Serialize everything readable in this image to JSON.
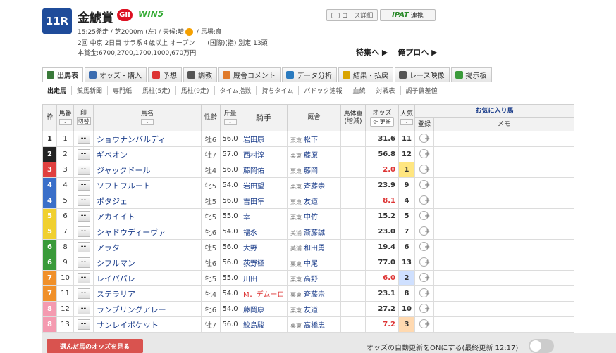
{
  "race": {
    "number": "11R",
    "name": "金鯱賞",
    "grade": "GII",
    "win5": "WIN5",
    "info_time": "15:25発走 / 芝2000m (左) / 天候:晴",
    "info_track": " / 馬場:良",
    "info_meet": "2回 中京 2日目 サラ系４歳以上 オープン　　(国際)(指) 別定 13頭",
    "info_prize": "本賞金:6700,2700,1700,1000,670万円",
    "course_btn": "コース詳細",
    "ipat_logo": "IPAT",
    "ipat_btn": "連携",
    "link_feature": "特集へ ▶",
    "link_pro": "俺プロへ ▶"
  },
  "tabs": [
    "出馬表",
    "オッズ・購入",
    "予想",
    "調教",
    "厩舎コメント",
    "データ分析",
    "結果・払戻",
    "レース映像",
    "掲示板"
  ],
  "tab_colors": [
    "#3a7a3a",
    "#3b6cb0",
    "#d33",
    "#555",
    "#e07a2a",
    "#2a7abf",
    "#d9a400",
    "#555",
    "#3a9a3a"
  ],
  "subtabs": [
    "出走馬",
    "競馬新聞",
    "専門紙",
    "馬柱(5走)",
    "馬柱(9走)",
    "タイム指数",
    "持ちタイム",
    "パドック速報",
    "血統",
    "対戦表",
    "調子偏差値"
  ],
  "headers": {
    "waku": "枠",
    "umaban": "馬番",
    "mark": "印",
    "mark_toggle": "切替",
    "horse": "馬名",
    "sexage": "性齢",
    "weight": "斤量",
    "jockey": "騎手",
    "trainer": "厩舎",
    "body_weight": "馬体重",
    "body_weight_sub": "(増減)",
    "odds": "オッズ",
    "odds_update": "更新",
    "popularity": "人気",
    "fav_group": "お気に入り馬",
    "fav_register": "登録",
    "memo": "メモ"
  },
  "rows": [
    {
      "waku": "1",
      "umaban": "1",
      "mark": "--",
      "horse": "ショウナンバルディ",
      "sexage": "牡6",
      "weight": "56.0",
      "jockey": "岩田康",
      "loc": "栗東",
      "trainer": "松下",
      "odds": "31.6",
      "pop": "11"
    },
    {
      "waku": "2",
      "umaban": "2",
      "mark": "--",
      "horse": "ギベオン",
      "sexage": "牡7",
      "weight": "57.0",
      "jockey": "西村淳",
      "loc": "栗東",
      "trainer": "藤原",
      "odds": "56.8",
      "pop": "12"
    },
    {
      "waku": "3",
      "umaban": "3",
      "mark": "--",
      "horse": "ジャックドール",
      "sexage": "牡4",
      "weight": "56.0",
      "jockey": "藤岡佑",
      "loc": "栗東",
      "trainer": "藤岡",
      "odds": "2.0",
      "pop": "1"
    },
    {
      "waku": "4",
      "umaban": "4",
      "mark": "--",
      "horse": "ソフトフルート",
      "sexage": "牝5",
      "weight": "54.0",
      "jockey": "岩田望",
      "loc": "栗東",
      "trainer": "斉藤崇",
      "odds": "23.9",
      "pop": "9"
    },
    {
      "waku": "4",
      "umaban": "5",
      "mark": "--",
      "horse": "ポタジェ",
      "sexage": "牡5",
      "weight": "56.0",
      "jockey": "吉田隼",
      "loc": "栗東",
      "trainer": "友道",
      "odds": "8.1",
      "pop": "4"
    },
    {
      "waku": "5",
      "umaban": "6",
      "mark": "--",
      "horse": "アカイイト",
      "sexage": "牝5",
      "weight": "55.0",
      "jockey": "幸",
      "loc": "栗東",
      "trainer": "中竹",
      "odds": "15.2",
      "pop": "5"
    },
    {
      "waku": "5",
      "umaban": "7",
      "mark": "--",
      "horse": "シャドウディーヴァ",
      "sexage": "牝6",
      "weight": "54.0",
      "jockey": "福永",
      "loc": "美浦",
      "trainer": "斎藤誠",
      "odds": "23.0",
      "pop": "7"
    },
    {
      "waku": "6",
      "umaban": "8",
      "mark": "--",
      "horse": "アラタ",
      "sexage": "牡5",
      "weight": "56.0",
      "jockey": "大野",
      "loc": "美浦",
      "trainer": "和田勇",
      "odds": "19.4",
      "pop": "6"
    },
    {
      "waku": "6",
      "umaban": "9",
      "mark": "--",
      "horse": "シフルマン",
      "sexage": "牡6",
      "weight": "56.0",
      "jockey": "荻野極",
      "loc": "栗東",
      "trainer": "中尾",
      "odds": "77.0",
      "pop": "13"
    },
    {
      "waku": "7",
      "umaban": "10",
      "mark": "--",
      "horse": "レイパパレ",
      "sexage": "牝5",
      "weight": "55.0",
      "jockey": "川田",
      "loc": "栗東",
      "trainer": "高野",
      "odds": "6.0",
      "pop": "2"
    },
    {
      "waku": "7",
      "umaban": "11",
      "mark": "--",
      "horse": "ステラリア",
      "sexage": "牝4",
      "weight": "54.0",
      "jockey": "M．デムーロ",
      "loc": "栗東",
      "trainer": "斉藤崇",
      "odds": "23.1",
      "pop": "8"
    },
    {
      "waku": "8",
      "umaban": "12",
      "mark": "--",
      "horse": "ランブリングアレー",
      "sexage": "牝6",
      "weight": "54.0",
      "jockey": "藤岡康",
      "loc": "栗東",
      "trainer": "友道",
      "odds": "27.2",
      "pop": "10"
    },
    {
      "waku": "8",
      "umaban": "13",
      "mark": "--",
      "horse": "サンレイポケット",
      "sexage": "牡7",
      "weight": "56.0",
      "jockey": "鮫島駿",
      "loc": "栗東",
      "trainer": "高橋忠",
      "odds": "7.2",
      "pop": "3"
    }
  ],
  "waku_colors": {
    "1": "#ffffff",
    "2": "#222222",
    "3": "#e0403f",
    "4": "#3a6fc9",
    "5": "#f0d030",
    "6": "#3a9a3a",
    "7": "#f0902a",
    "8": "#f49ab0"
  },
  "waku_text": {
    "1": "#333",
    "2": "#fff",
    "3": "#fff",
    "4": "#fff",
    "5": "#fff",
    "6": "#fff",
    "7": "#fff",
    "8": "#fff"
  },
  "pop_colors": {
    "1": "#ffe680",
    "2": "#cfe0ff",
    "3": "#ffd9b0"
  },
  "hot_odds": [
    "2.0",
    "8.1",
    "6.0",
    "7.2"
  ],
  "footer": {
    "odds_button": "選んだ馬のオッズを見る",
    "auto_update": "オッズの自動更新をONにする(最終更新 12:17)"
  }
}
